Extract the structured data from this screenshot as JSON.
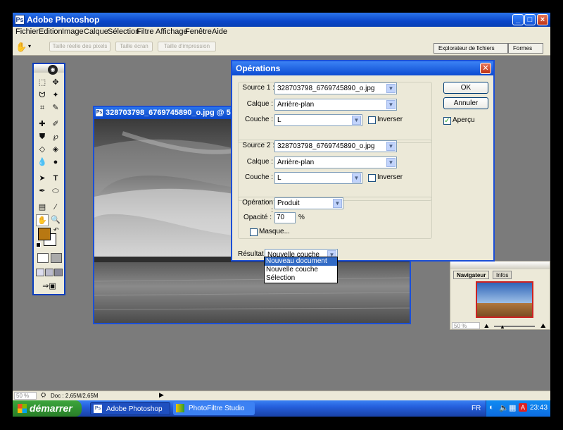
{
  "app": {
    "title": "Adobe Photoshop",
    "window_controls": {
      "minimize": "_",
      "maximize": "□",
      "close": "×"
    }
  },
  "menu": [
    "Fichier",
    "Edition",
    "Image",
    "Calque",
    "Sélection",
    "Filtre",
    "Affichage",
    "Fenêtre",
    "Aide"
  ],
  "options_bar": {
    "buttons": [
      "Taille réelle des pixels",
      "Taille écran",
      "Taille d'impression"
    ],
    "tabs": [
      "Explorateur de fichiers",
      "Formes"
    ]
  },
  "document": {
    "title": "328703798_6769745890_o.jpg @ 50%"
  },
  "dialog": {
    "title": "Opérations",
    "source1": {
      "label": "Source 1 :",
      "file": "328703798_6769745890_o.jpg",
      "calque_label": "Calque :",
      "calque": "Arrière-plan",
      "couche_label": "Couche :",
      "couche": "L",
      "inverser": "Inverser"
    },
    "source2": {
      "label": "Source 2 :",
      "file": "328703798_6769745890_o.jpg",
      "calque_label": "Calque :",
      "calque": "Arrière-plan",
      "couche_label": "Couche :",
      "couche": "L",
      "inverser": "Inverser"
    },
    "operation": {
      "label": "Opération :",
      "value": "Produit",
      "opacite_label": "Opacité :",
      "opacite": "70",
      "percent": "%",
      "masque": "Masque..."
    },
    "resultat": {
      "label": "Résultat :",
      "value": "Nouvelle couche",
      "options": [
        "Nouveau document",
        "Nouvelle couche",
        "Sélection"
      ]
    },
    "ok": "OK",
    "annuler": "Annuler",
    "apercu": "Aperçu"
  },
  "navigator": {
    "tabs": [
      "Navigateur",
      "Infos"
    ],
    "zoom": "50 %"
  },
  "status": {
    "zoom": "50 %",
    "doc": "Doc : 2,65M/2,65M"
  },
  "taskbar": {
    "start": "démarrer",
    "tasks": [
      "Adobe Photoshop",
      "PhotoFiltre Studio"
    ],
    "lang": "FR",
    "time": "23:43"
  }
}
